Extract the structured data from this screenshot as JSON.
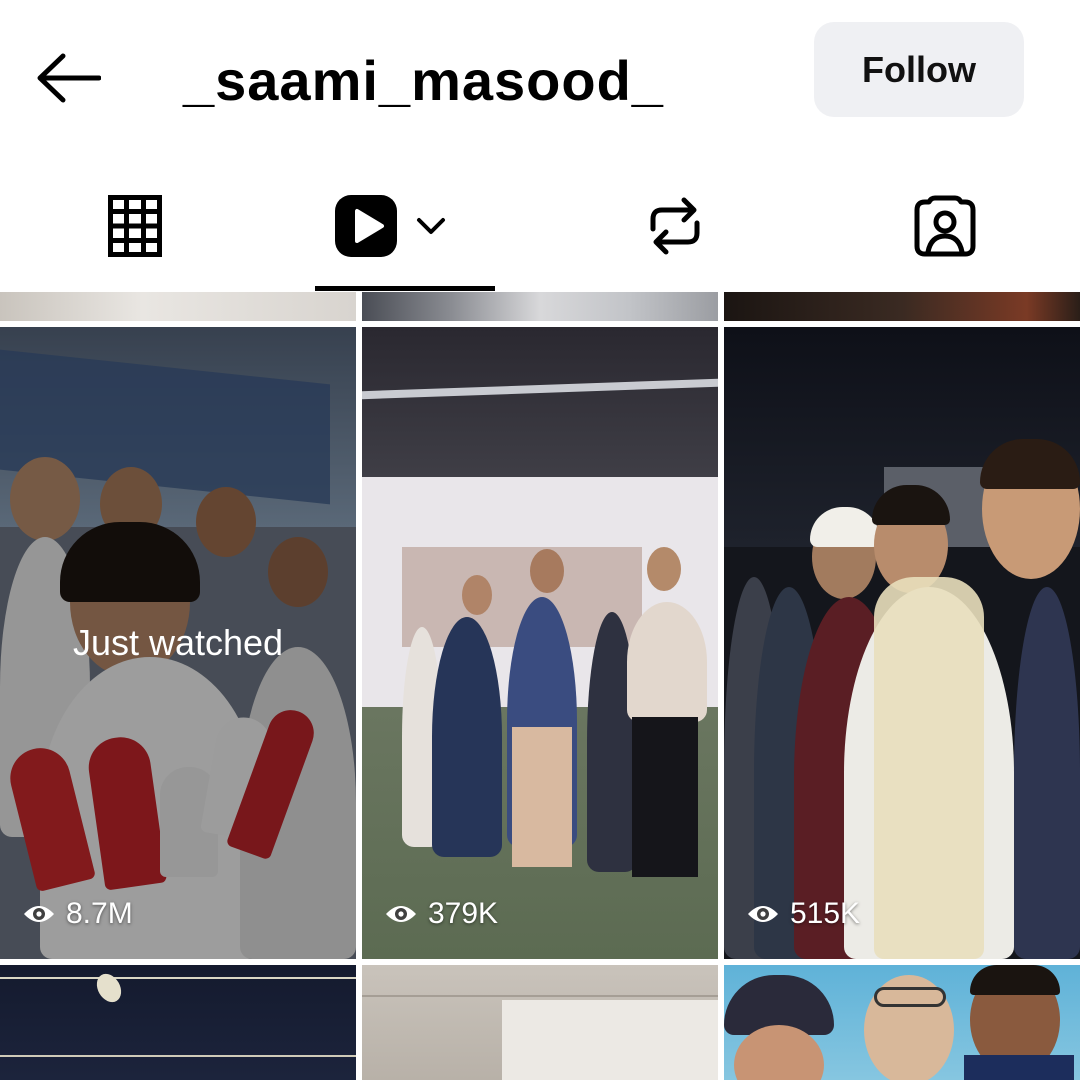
{
  "header": {
    "username": "_saami_masood_",
    "follow_label": "Follow",
    "back_icon": "arrow-left-icon"
  },
  "tabs": [
    {
      "name": "posts",
      "icon": "grid-icon",
      "active": false
    },
    {
      "name": "reels",
      "icon": "reels-play-icon",
      "active": true,
      "has_dropdown": true
    },
    {
      "name": "reposts",
      "icon": "repost-icon",
      "active": false
    },
    {
      "name": "tagged",
      "icon": "tagged-person-icon",
      "active": false
    }
  ],
  "reels": {
    "just_watched_label": "Just watched",
    "items": [
      {
        "views": "8.7M",
        "just_watched": true
      },
      {
        "views": "379K",
        "just_watched": false
      },
      {
        "views": "515K",
        "just_watched": false
      }
    ]
  },
  "colors": {
    "follow_bg": "#eff0f3",
    "text": "#000000",
    "overlay_text": "#ffffff"
  }
}
